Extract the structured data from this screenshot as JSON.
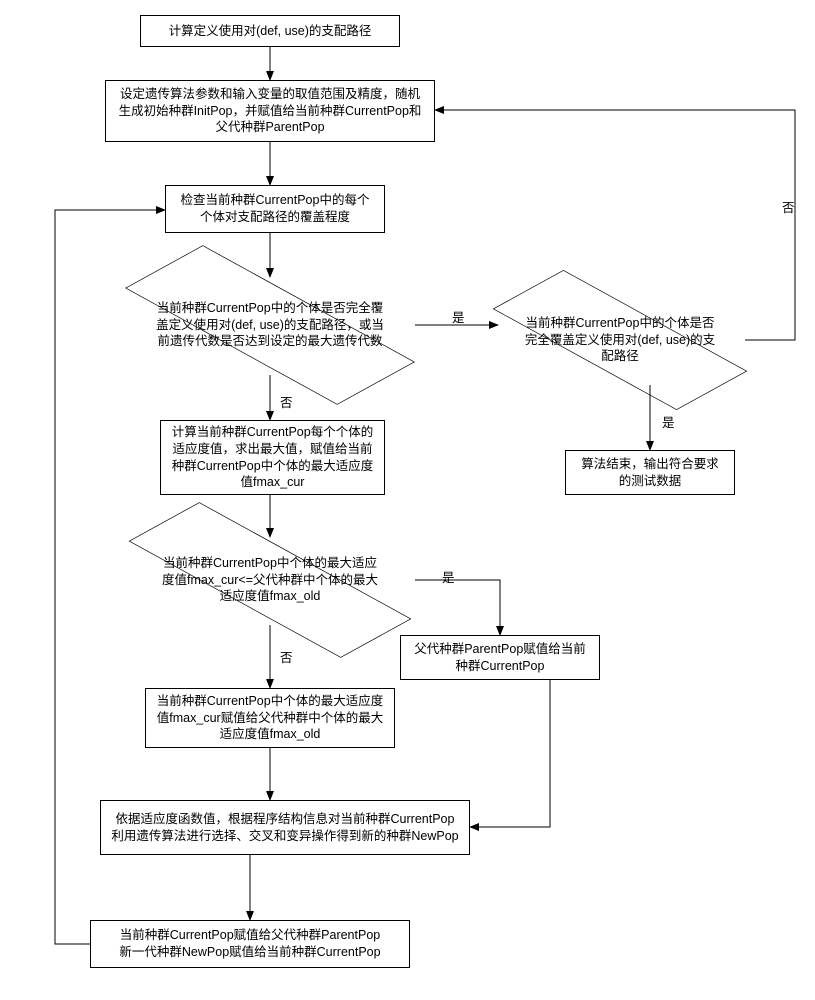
{
  "nodes": {
    "n1": "计算定义使用对(def, use)的支配路径",
    "n2": "设定遗传算法参数和输入变量的取值范围及精度，随机生成初始种群InitPop，并赋值给当前种群CurrentPop和父代种群ParentPop",
    "n3": "检查当前种群CurrentPop中的每个个体对支配路径的覆盖程度",
    "d1": "当前种群CurrentPop中的个体是否完全覆盖定义使用对(def, use)的支配路径，或当前遗传代数是否达到设定的最大遗传代数",
    "d2": "当前种群CurrentPop中的个体是否完全覆盖定义使用对(def, use)的支配路径",
    "n4": "算法结束，输出符合要求的测试数据",
    "n5": "计算当前种群CurrentPop每个个体的适应度值，求出最大值，赋值给当前种群CurrentPop中个体的最大适应度值fmax_cur",
    "d3": "当前种群CurrentPop中个体的最大适应度值fmax_cur<=父代种群中个体的最大适应度值fmax_old",
    "n6": "父代种群ParentPop赋值给当前种群CurrentPop",
    "n7": "当前种群CurrentPop中个体的最大适应度值fmax_cur赋值给父代种群中个体的最大适应度值fmax_old",
    "n8": "依据适应度函数值，根据程序结构信息对当前种群CurrentPop利用遗传算法进行选择、交叉和变异操作得到新的种群NewPop",
    "n9": "当前种群CurrentPop赋值给父代种群ParentPop\n新一代种群NewPop赋值给当前种群CurrentPop"
  },
  "labels": {
    "yes": "是",
    "no": "否"
  },
  "chart_data": {
    "type": "flowchart",
    "title": "",
    "nodes": [
      {
        "id": "n1",
        "kind": "process",
        "text": "计算定义使用对(def, use)的支配路径"
      },
      {
        "id": "n2",
        "kind": "process",
        "text": "设定遗传算法参数和输入变量的取值范围及精度，随机生成初始种群InitPop，并赋值给当前种群CurrentPop和父代种群ParentPop"
      },
      {
        "id": "n3",
        "kind": "process",
        "text": "检查当前种群CurrentPop中的每个个体对支配路径的覆盖程度"
      },
      {
        "id": "d1",
        "kind": "decision",
        "text": "当前种群CurrentPop中的个体是否完全覆盖定义使用对(def, use)的支配路径，或当前遗传代数是否达到设定的最大遗传代数"
      },
      {
        "id": "d2",
        "kind": "decision",
        "text": "当前种群CurrentPop中的个体是否完全覆盖定义使用对(def, use)的支配路径"
      },
      {
        "id": "n4",
        "kind": "terminator",
        "text": "算法结束，输出符合要求的测试数据"
      },
      {
        "id": "n5",
        "kind": "process",
        "text": "计算当前种群CurrentPop每个个体的适应度值，求出最大值，赋值给当前种群CurrentPop中个体的最大适应度值fmax_cur"
      },
      {
        "id": "d3",
        "kind": "decision",
        "text": "当前种群CurrentPop中个体的最大适应度值fmax_cur<=父代种群中个体的最大适应度值fmax_old"
      },
      {
        "id": "n6",
        "kind": "process",
        "text": "父代种群ParentPop赋值给当前种群CurrentPop"
      },
      {
        "id": "n7",
        "kind": "process",
        "text": "当前种群CurrentPop中个体的最大适应度值fmax_cur赋值给父代种群中个体的最大适应度值fmax_old"
      },
      {
        "id": "n8",
        "kind": "process",
        "text": "依据适应度函数值，根据程序结构信息对当前种群CurrentPop利用遗传算法进行选择、交叉和变异操作得到新的种群NewPop"
      },
      {
        "id": "n9",
        "kind": "process",
        "text": "当前种群CurrentPop赋值给父代种群ParentPop 新一代种群NewPop赋值给当前种群CurrentPop"
      }
    ],
    "edges": [
      {
        "from": "n1",
        "to": "n2"
      },
      {
        "from": "n2",
        "to": "n3"
      },
      {
        "from": "n3",
        "to": "d1"
      },
      {
        "from": "d1",
        "to": "d2",
        "label": "是"
      },
      {
        "from": "d1",
        "to": "n5",
        "label": "否"
      },
      {
        "from": "d2",
        "to": "n4",
        "label": "是"
      },
      {
        "from": "d2",
        "to": "n2",
        "label": "否"
      },
      {
        "from": "n5",
        "to": "d3"
      },
      {
        "from": "d3",
        "to": "n6",
        "label": "是"
      },
      {
        "from": "d3",
        "to": "n7",
        "label": "否"
      },
      {
        "from": "n6",
        "to": "n8"
      },
      {
        "from": "n7",
        "to": "n8"
      },
      {
        "from": "n8",
        "to": "n9"
      },
      {
        "from": "n9",
        "to": "n3"
      }
    ]
  }
}
